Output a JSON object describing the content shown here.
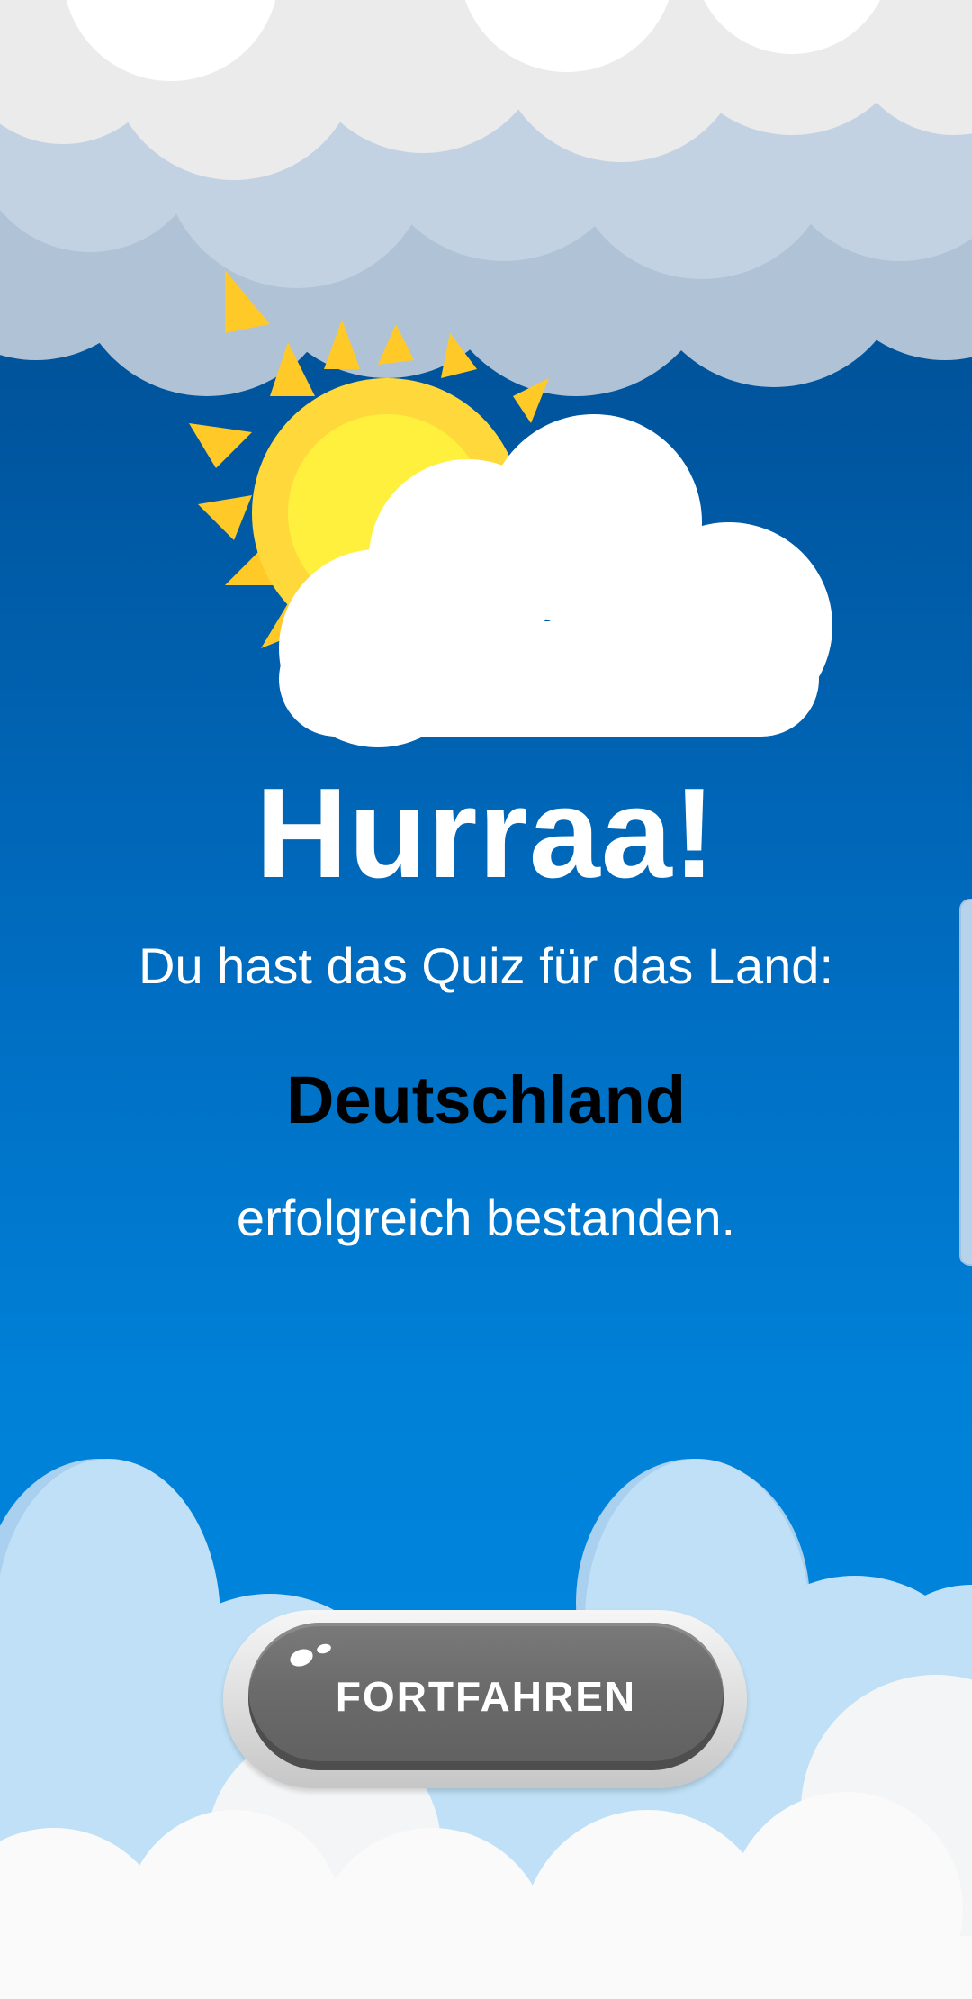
{
  "screen": {
    "title": "Hurraa!",
    "message_before": "Du hast das Quiz für das Land:",
    "country": "Deutschland",
    "message_after": "erfolgreich bestanden.",
    "continue_button_label": "FORTFAHREN"
  },
  "colors": {
    "sky_top": "#004a8e",
    "sky_bottom": "#0089e2",
    "text": "#ffffff",
    "country_text": "#000000",
    "button_body": "#6b6b6b",
    "button_rim": "#e6e6e6",
    "sun": "#ffd93b",
    "cloud": "#ffffff"
  },
  "icons": {
    "weather": "sun-behind-cloud-icon"
  }
}
